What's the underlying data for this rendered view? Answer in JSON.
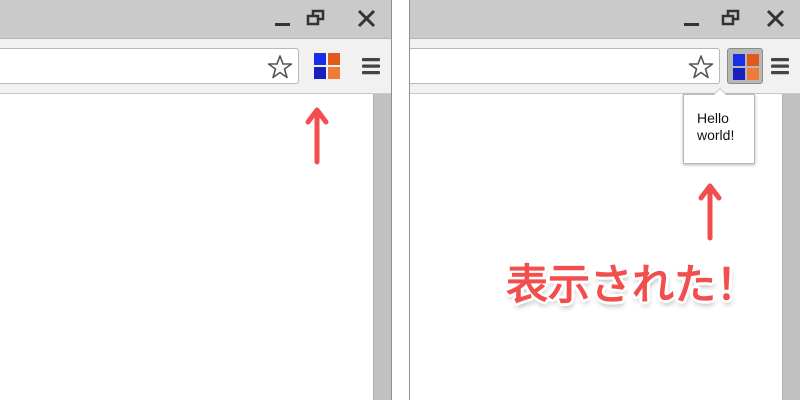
{
  "colors": {
    "titlebar": "#cacaca",
    "toolbar": "#f1f1f1",
    "scrollbar": "#c1c1c1",
    "arrow": "#f24e4e",
    "annotation": "#f24e4e",
    "extension_logo": [
      "#1a2ee6",
      "#e05a1a",
      "#1a1fc2",
      "#f07a3a"
    ]
  },
  "icons": {
    "minimize": "minimize-icon",
    "restore": "restore-icon",
    "close": "close-icon",
    "bookmark": "star-icon",
    "extension": "extension-logo-icon",
    "menu": "hamburger-menu-icon",
    "arrow": "up-arrow-icon"
  },
  "before": {
    "omnibox": {
      "value": ""
    },
    "extension_popup_open": false
  },
  "after": {
    "omnibox": {
      "value": ""
    },
    "extension_popup_open": true,
    "popup": {
      "text": "Hello world!"
    },
    "annotation": "表示された！"
  }
}
